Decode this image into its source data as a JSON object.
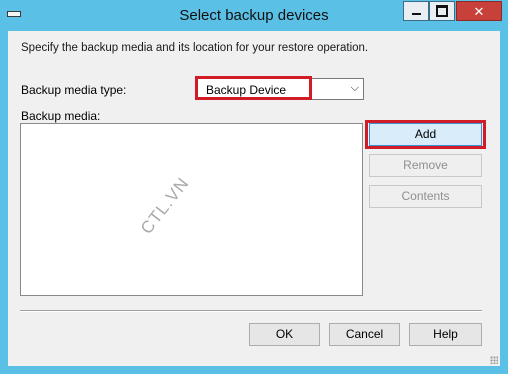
{
  "window": {
    "title": "Select backup devices",
    "icons": {
      "system": "system-menu-icon",
      "minimize": "minimize-icon",
      "maximize": "maximize-icon",
      "close": "close-icon"
    },
    "colors": {
      "frame": "#5bc0e6",
      "close": "#c7403a",
      "highlight": "#d01c27"
    }
  },
  "dialog": {
    "description": "Specify the backup media and its location for your restore operation.",
    "media_type_label": "Backup media type:",
    "media_type_value": "Backup Device",
    "media_label": "Backup media:",
    "media_items": [],
    "watermark": "CTL.VN",
    "buttons": {
      "add": "Add",
      "remove": "Remove",
      "contents": "Contents"
    },
    "footer": {
      "ok": "OK",
      "cancel": "Cancel",
      "help": "Help"
    }
  }
}
